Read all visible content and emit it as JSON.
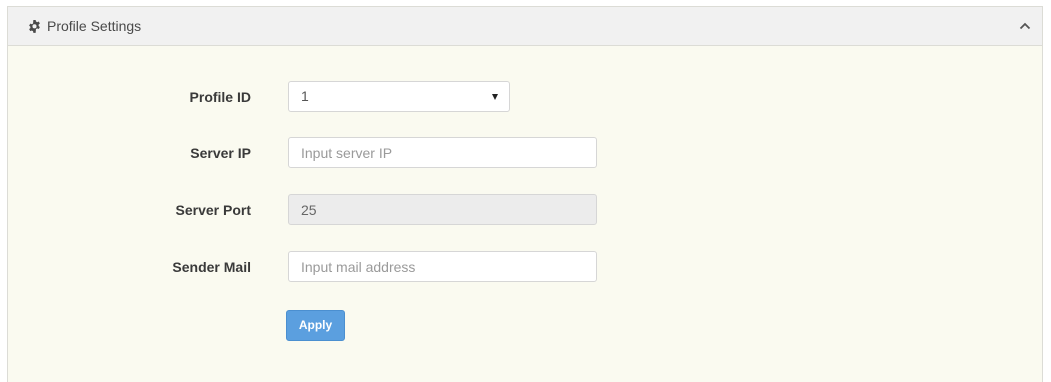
{
  "panel": {
    "title": "Profile Settings",
    "icon": "gear-icon",
    "collapse_icon": "chevron-up-icon"
  },
  "form": {
    "profile_id": {
      "label": "Profile ID",
      "value": "1"
    },
    "server_ip": {
      "label": "Server IP",
      "value": "",
      "placeholder": "Input server IP"
    },
    "server_port": {
      "label": "Server Port",
      "value": "25"
    },
    "sender_mail": {
      "label": "Sender Mail",
      "value": "",
      "placeholder": "Input mail address"
    },
    "apply_label": "Apply"
  },
  "colors": {
    "panel_background": "#fafaf0",
    "header_background": "#f1f1f1",
    "apply_button": "#5b9fdf",
    "readonly_field": "#ececec"
  }
}
